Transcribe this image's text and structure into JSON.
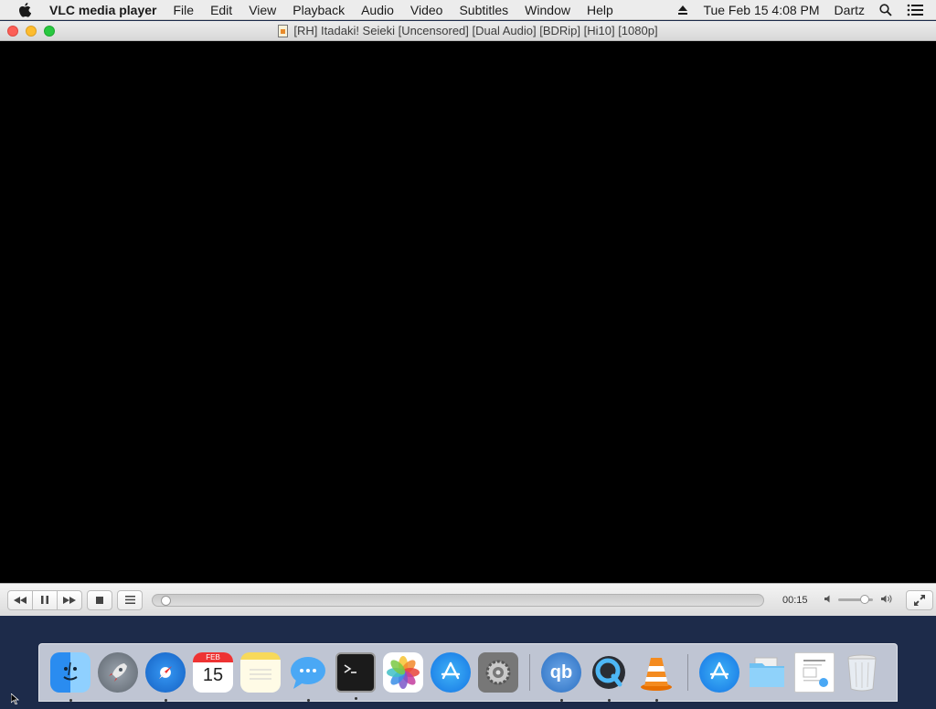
{
  "menubar": {
    "app_name": "VLC media player",
    "items": [
      "File",
      "Edit",
      "View",
      "Playback",
      "Audio",
      "Video",
      "Subtitles",
      "Window",
      "Help"
    ],
    "clock": "Tue Feb 15  4:08 PM",
    "user": "Dartz"
  },
  "window": {
    "title": "[RH] Itadaki! Seieki [Uncensored] [Dual Audio] [BDRip] [Hi10] [1080p]"
  },
  "player": {
    "time": "00:15",
    "progress_fraction": 0.01,
    "volume_fraction": 0.85
  },
  "dock": {
    "calendar_month": "FEB",
    "calendar_day": "15",
    "qbittorrent_label": "qb",
    "items": [
      {
        "name": "finder",
        "running": true
      },
      {
        "name": "launchpad",
        "running": false
      },
      {
        "name": "safari",
        "running": true
      },
      {
        "name": "calendar",
        "running": false
      },
      {
        "name": "notes",
        "running": false
      },
      {
        "name": "messages",
        "running": true
      },
      {
        "name": "terminal",
        "running": true
      },
      {
        "name": "photos",
        "running": false
      },
      {
        "name": "app-store",
        "running": false
      },
      {
        "name": "system-preferences",
        "running": false
      },
      {
        "name": "qbittorrent",
        "running": true
      },
      {
        "name": "quicktime",
        "running": true
      },
      {
        "name": "vlc",
        "running": true
      },
      {
        "name": "downloads-stack",
        "running": false
      },
      {
        "name": "folder-stack",
        "running": false
      },
      {
        "name": "documents-stack",
        "running": false
      },
      {
        "name": "trash",
        "running": false
      }
    ]
  }
}
